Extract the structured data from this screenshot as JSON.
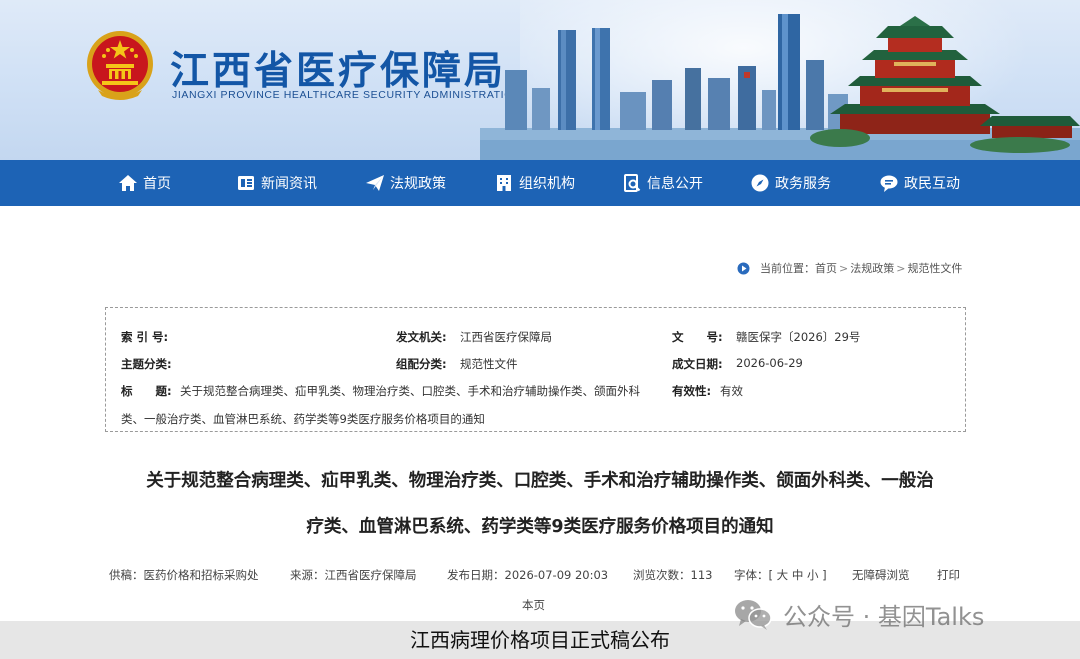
{
  "header": {
    "title": "江西省医疗保障局",
    "subtitle": "JIANGXI PROVINCE HEALTHCARE SECURITY ADMINISTRATION"
  },
  "nav": {
    "items": [
      {
        "label": "首页",
        "icon": "home-icon"
      },
      {
        "label": "新闻资讯",
        "icon": "news-icon"
      },
      {
        "label": "法规政策",
        "icon": "paper-plane-icon"
      },
      {
        "label": "组织机构",
        "icon": "building-icon"
      },
      {
        "label": "信息公开",
        "icon": "document-search-icon"
      },
      {
        "label": "政务服务",
        "icon": "compass-icon"
      },
      {
        "label": "政民互动",
        "icon": "chat-icon"
      }
    ]
  },
  "breadcrumb": {
    "prefix": "当前位置：",
    "items": [
      "首页",
      "法规政策",
      "规范性文件"
    ],
    "separator": ">"
  },
  "info": {
    "index_label": "索 引 号:",
    "index_value": "",
    "issuer_label": "发文机关:",
    "issuer_value": "江西省医疗保障局",
    "docno_label": "文　　号:",
    "docno_value": "赣医保字〔2026〕29号",
    "topic_label": "主题分类:",
    "topic_value": "",
    "category_label": "组配分类:",
    "category_value": "规范性文件",
    "date_label": "成文日期:",
    "date_value": "2026-06-29",
    "title_label": "标　　题:",
    "title_value_line1": "关于规范整合病理类、疝甲乳类、物理治疗类、口腔类、手术和治疗辅助操作类、颌面外科",
    "title_value_line2": "类、一般治疗类、血管淋巴系统、药学类等9类医疗服务价格项目的通知",
    "validity_label": "有效性:",
    "validity_value": "有效"
  },
  "article": {
    "title_line1": "关于规范整合病理类、疝甲乳类、物理治疗类、口腔类、手术和治疗辅助操作类、颌面外科类、一般治",
    "title_line2": "疗类、血管淋巴系统、药学类等9类医疗服务价格项目的通知"
  },
  "meta": {
    "author": "供稿：医药价格和招标采购处",
    "source": "来源：江西省医疗保障局",
    "publish_date": "发布日期：2026-07-09 20:03",
    "views": "浏览次数：113",
    "font_prefix": "字体：[",
    "font_large": "大",
    "font_medium": "中",
    "font_small": "小",
    "font_suffix": "]",
    "accessibility": "无障碍浏览",
    "print_part1": "打印",
    "print_part2": "本页"
  },
  "caption": "江西病理价格项目正式稿公布",
  "watermark": "公众号 · 基因Talks",
  "colors": {
    "nav_bg": "#1d63b5",
    "title_blue": "#1356a6",
    "caption_bg": "#e6e6e6"
  }
}
